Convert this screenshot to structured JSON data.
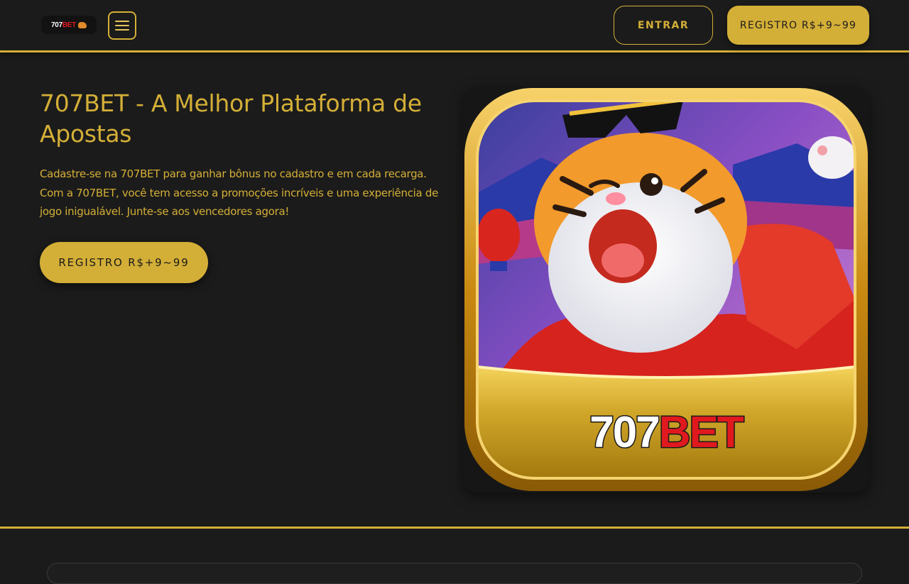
{
  "header": {
    "logo": {
      "text_white": "707",
      "text_red": "BET"
    },
    "menu_icon": "hamburger-icon",
    "login_label": "ENTRAR",
    "register_label": "REGISTRO R$+9~99"
  },
  "hero": {
    "title": "707BET - A Melhor Plataforma de Apostas",
    "description": "Cadastre-se na 707BET para ganhar bônus no cadastro e em cada recarga. Com a 707BET, você tem acesso a promoções incríveis e uma experiência de jogo inigualável. Junte-se aos vencedores agora!",
    "register_label": "REGISTRO R$+9~99",
    "image": {
      "subject": "tiger-game-icon",
      "banner_white": "707",
      "banner_red": "BET"
    }
  },
  "colors": {
    "background": "#1b1b1b",
    "accent_gold": "#d4af37",
    "brand_red": "#e0191f"
  }
}
